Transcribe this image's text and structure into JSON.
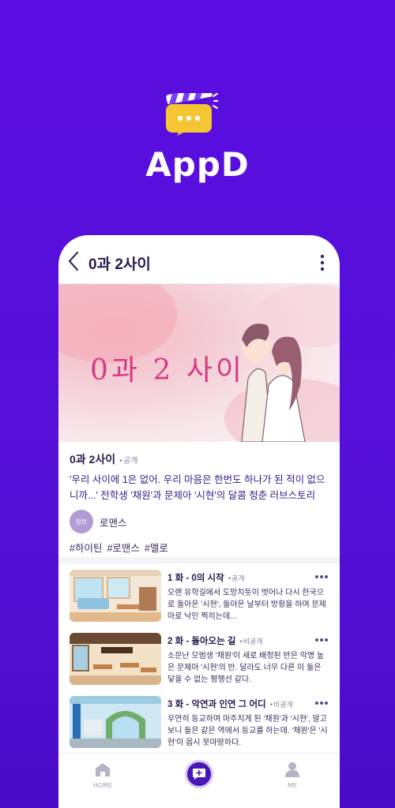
{
  "app": {
    "logo_text": "AppD"
  },
  "header": {
    "title": "0과 2사이"
  },
  "hero": {
    "artwork_text": "0과 2 사이"
  },
  "series": {
    "title": "0과 2사이",
    "status": "•공개",
    "description": "'우리 사이에 1은 없어. 우리 마음은 한번도 하나가 된 적이 없으니까...' 전학생 '채원'과 문제아 '시현'의 달콤 청춘 러브스토리",
    "genre_badge": "장르",
    "genre": "로맨스",
    "tags": [
      "#하이틴",
      "#로맨스",
      "#멜로"
    ]
  },
  "episodes": [
    {
      "title": "1 화 - 0의 시작",
      "status": "•공개",
      "description": "오랜 유학길에서 도망치듯이 벗어나 다시 한국으로 돌아온 '시현', 돌아온 날부터 방황을 하며 문제아로 낙인 찍히는데..."
    },
    {
      "title": "2 화 - 돌아오는 길",
      "status": "•비공개",
      "description": "소문난 모범생 '채원'이 새로 배정된 반은 악명 높은 문제아 '시현'의 반. 달라도 너무 다른 이 둘은 닿을 수 없는 평행선 같다."
    },
    {
      "title": "3 화 - 악연과 인연 그 어디",
      "status": "•비공개",
      "description": "우연히 등교하며 마주치게 된 '채원'과 '시현', 알고보니 둘은 같은 역에서 등교를 하는데. '채원'은 '시현'이 몹시 못마땅하다."
    }
  ],
  "tabbar": {
    "home_label": "HOME",
    "me_label": "ME"
  },
  "colors": {
    "background": "#5510d8",
    "accent": "#4a16b6",
    "logo_yellow": "#f5c634",
    "logo_purple": "#7a3ff0"
  }
}
